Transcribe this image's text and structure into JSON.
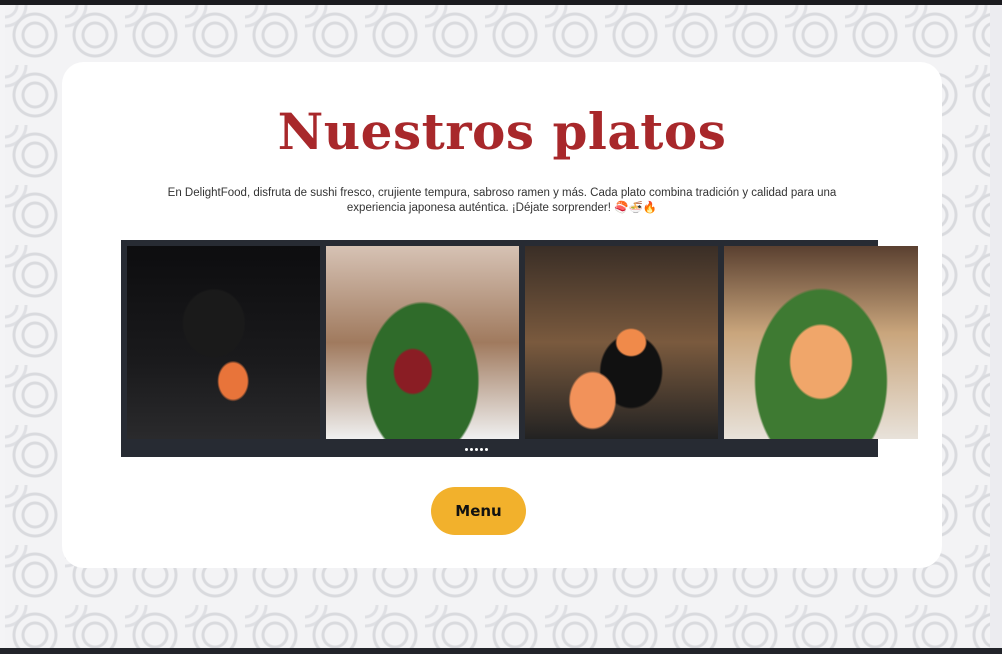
{
  "section": {
    "title": "Nuestros platos",
    "description": "En DelightFood, disfruta de sushi fresco, crujiente tempura, sabroso ramen y más. Cada plato combina tradición y calidad para una experiencia japonesa auténtica. ¡Déjate sorprender! 🍣🍜🔥"
  },
  "carousel": {
    "slides": [
      {
        "name": "salmon-nigiri-gloved-hand"
      },
      {
        "name": "tuna-nigiri-chopsticks"
      },
      {
        "name": "shrimp-nigiri-soy-sauce"
      },
      {
        "name": "seared-salmon-nigiri"
      }
    ],
    "dot_count": 5
  },
  "menu_button": {
    "label": "Menu"
  },
  "colors": {
    "title": "#a8282b",
    "button": "#f2b12c",
    "carousel_bg": "#272b33"
  }
}
